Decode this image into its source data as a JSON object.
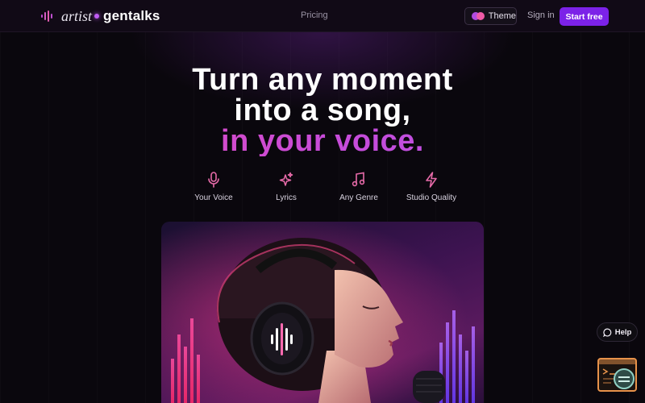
{
  "nav": {
    "brand_artist": "artist",
    "brand_gentalks": "gentalks",
    "pricing": "Pricing",
    "theme": "Theme",
    "sign_in": "Sign in",
    "start_free": "Start free"
  },
  "hero": {
    "title_line1": "Turn any moment",
    "title_line2": "into a song,",
    "title_line3": "in your voice."
  },
  "features": [
    {
      "label": "Your Voice",
      "icon": "microphone-icon"
    },
    {
      "label": "Lyrics",
      "icon": "sparkles-icon"
    },
    {
      "label": "Any Genre",
      "icon": "music-note-icon"
    },
    {
      "label": "Studio Quality",
      "icon": "lightning-icon"
    }
  ],
  "widgets": {
    "help": "Help"
  },
  "colors": {
    "accent_purple": "#7c22e8",
    "accent_pink": "#e94bb4",
    "background": "#0a070d",
    "icon_pink": "#e66aa8"
  }
}
